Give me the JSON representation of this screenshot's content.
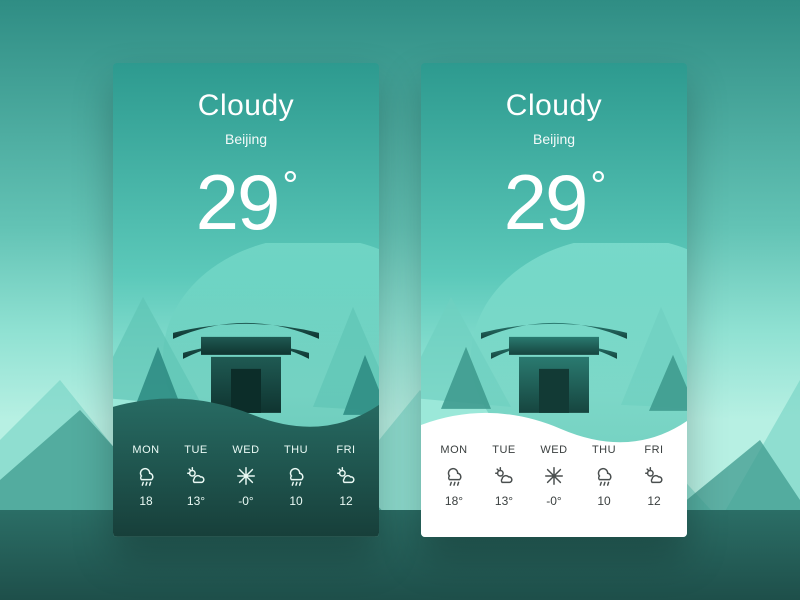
{
  "cards": [
    {
      "variant": "dark",
      "condition": "Cloudy",
      "city": "Beijing",
      "temperature": "29",
      "degree_symbol": "°",
      "forecast": [
        {
          "day": "MON",
          "icon": "rain",
          "temp": "18"
        },
        {
          "day": "TUE",
          "icon": "partly-sunny",
          "temp": "13°"
        },
        {
          "day": "WED",
          "icon": "snow",
          "temp": "-0°"
        },
        {
          "day": "THU",
          "icon": "rain",
          "temp": "10"
        },
        {
          "day": "FRI",
          "icon": "partly-sunny",
          "temp": "12"
        }
      ]
    },
    {
      "variant": "light",
      "condition": "Cloudy",
      "city": "Beijing",
      "temperature": "29",
      "degree_symbol": "°",
      "forecast": [
        {
          "day": "MON",
          "icon": "rain",
          "temp": "18°"
        },
        {
          "day": "TUE",
          "icon": "partly-sunny",
          "temp": "13°"
        },
        {
          "day": "WED",
          "icon": "snow",
          "temp": "-0°"
        },
        {
          "day": "THU",
          "icon": "rain",
          "temp": "10"
        },
        {
          "day": "FRI",
          "icon": "partly-sunny",
          "temp": "12"
        }
      ]
    }
  ],
  "colors": {
    "teal_dark": "#1e5a53",
    "teal_mid": "#2f8d84",
    "teal_light": "#8fe1d2"
  }
}
